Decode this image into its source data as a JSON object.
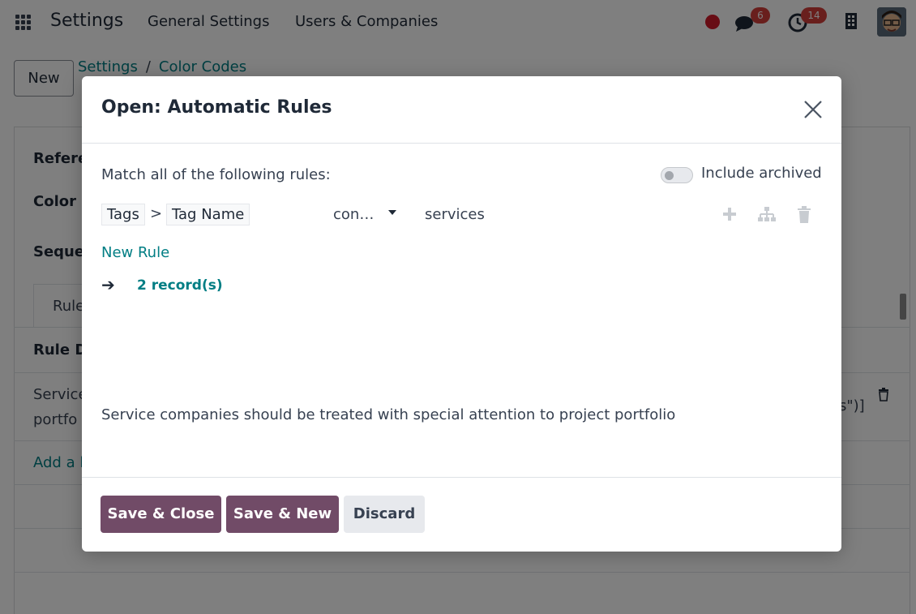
{
  "navbar": {
    "app_name": "Settings",
    "menu_general": "General Settings",
    "menu_users": "Users & Companies",
    "messages_count": "6",
    "activities_count": "14"
  },
  "breadcrumb": {
    "new_label": "New",
    "parent": "Settings",
    "separator": "/",
    "current": "Color Codes"
  },
  "background_form": {
    "label_reference": "Refere",
    "label_color": "Color",
    "label_sequence": "Seque",
    "tab_rules": "Rule",
    "section_rule": "Rule D",
    "row_text_1": "Service",
    "row_text_2": "portfo",
    "row_tail": "s\")]",
    "add_line": "Add a l"
  },
  "modal": {
    "title": "Open: Automatic Rules",
    "match_text": "Match all of the following rules:",
    "include_archived": "Include archived",
    "rule": {
      "path_field_1": "Tags",
      "path_separator": ">",
      "path_field_2": "Tag Name",
      "operator": "con…",
      "value": "services"
    },
    "new_rule": "New Rule",
    "records": "2 record(s)",
    "description": "Service companies should be treated with special attention to project portfolio",
    "buttons": {
      "save_close": "Save & Close",
      "save_new": "Save & New",
      "discard": "Discard"
    }
  },
  "colors": {
    "primary": "#714b67",
    "link": "#017e84",
    "badge": "#d23f3a"
  }
}
